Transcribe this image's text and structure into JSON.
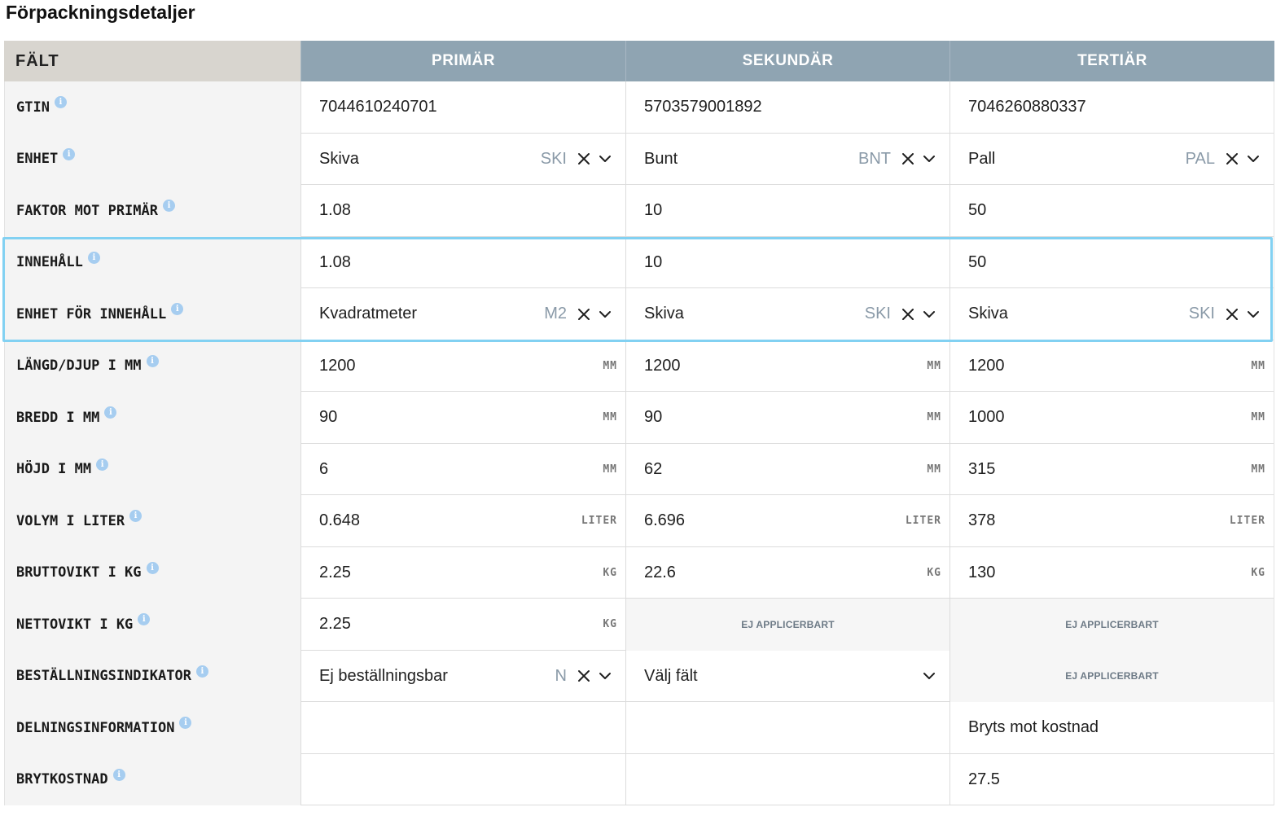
{
  "page": {
    "title": "Förpackningsdetaljer"
  },
  "header": {
    "field": "FÄLT",
    "primary": "PRIMÄR",
    "secondary": "SEKUNDÄR",
    "tertiary": "TERTIÄR"
  },
  "na_text": "EJ APPLICERBART",
  "colors": {
    "header_bg": "#8fa4b2",
    "first_header_bg": "#d8d5cf",
    "highlight_border": "#82d1f2",
    "info_icon": "#a6cdf0"
  },
  "rows": [
    {
      "label": "GTIN",
      "cells": [
        {
          "type": "text",
          "value": "7044610240701"
        },
        {
          "type": "text",
          "value": "5703579001892"
        },
        {
          "type": "text",
          "value": "7046260880337"
        }
      ]
    },
    {
      "label": "ENHET",
      "cells": [
        {
          "type": "select",
          "value": "Skiva",
          "code": "SKI"
        },
        {
          "type": "select",
          "value": "Bunt",
          "code": "BNT"
        },
        {
          "type": "select",
          "value": "Pall",
          "code": "PAL"
        }
      ]
    },
    {
      "label": "FAKTOR MOT PRIMÄR",
      "cells": [
        {
          "type": "text",
          "value": "1.08"
        },
        {
          "type": "text",
          "value": "10"
        },
        {
          "type": "text",
          "value": "50"
        }
      ]
    },
    {
      "label": "INNEHÅLL",
      "cells": [
        {
          "type": "text",
          "value": "1.08"
        },
        {
          "type": "text",
          "value": "10"
        },
        {
          "type": "text",
          "value": "50"
        }
      ]
    },
    {
      "label": "ENHET FÖR INNEHÅLL",
      "cells": [
        {
          "type": "select",
          "value": "Kvadratmeter",
          "code": "M2"
        },
        {
          "type": "select",
          "value": "Skiva",
          "code": "SKI"
        },
        {
          "type": "select",
          "value": "Skiva",
          "code": "SKI"
        }
      ]
    },
    {
      "label": "LÄNGD/DJUP I MM",
      "cells": [
        {
          "type": "unit",
          "value": "1200",
          "unit": "MM"
        },
        {
          "type": "unit",
          "value": "1200",
          "unit": "MM"
        },
        {
          "type": "unit",
          "value": "1200",
          "unit": "MM"
        }
      ]
    },
    {
      "label": "BREDD I MM",
      "cells": [
        {
          "type": "unit",
          "value": "90",
          "unit": "MM"
        },
        {
          "type": "unit",
          "value": "90",
          "unit": "MM"
        },
        {
          "type": "unit",
          "value": "1000",
          "unit": "MM"
        }
      ]
    },
    {
      "label": "HÖJD I MM",
      "cells": [
        {
          "type": "unit",
          "value": "6",
          "unit": "MM"
        },
        {
          "type": "unit",
          "value": "62",
          "unit": "MM"
        },
        {
          "type": "unit",
          "value": "315",
          "unit": "MM"
        }
      ]
    },
    {
      "label": "VOLYM I LITER",
      "cells": [
        {
          "type": "unit",
          "value": "0.648",
          "unit": "LITER"
        },
        {
          "type": "unit",
          "value": "6.696",
          "unit": "LITER"
        },
        {
          "type": "unit",
          "value": "378",
          "unit": "LITER"
        }
      ]
    },
    {
      "label": "BRUTTOVIKT I KG",
      "cells": [
        {
          "type": "unit",
          "value": "2.25",
          "unit": "KG"
        },
        {
          "type": "unit",
          "value": "22.6",
          "unit": "KG"
        },
        {
          "type": "unit",
          "value": "130",
          "unit": "KG"
        }
      ]
    },
    {
      "label": "NETTOVIKT I KG",
      "cells": [
        {
          "type": "unit",
          "value": "2.25",
          "unit": "KG"
        },
        {
          "type": "na"
        },
        {
          "type": "na"
        }
      ]
    },
    {
      "label": "BESTÄLLNINGSINDIKATOR",
      "cells": [
        {
          "type": "select",
          "value": "Ej beställningsbar",
          "code": "N"
        },
        {
          "type": "placeholder-select",
          "value": "Välj fält"
        },
        {
          "type": "na"
        }
      ]
    },
    {
      "label": "DELNINGSINFORMATION",
      "cells": [
        {
          "type": "empty"
        },
        {
          "type": "empty"
        },
        {
          "type": "text",
          "value": "Bryts mot kostnad"
        }
      ]
    },
    {
      "label": "BRYTKOSTNAD",
      "cells": [
        {
          "type": "empty"
        },
        {
          "type": "empty"
        },
        {
          "type": "text",
          "value": "27.5"
        }
      ]
    }
  ]
}
